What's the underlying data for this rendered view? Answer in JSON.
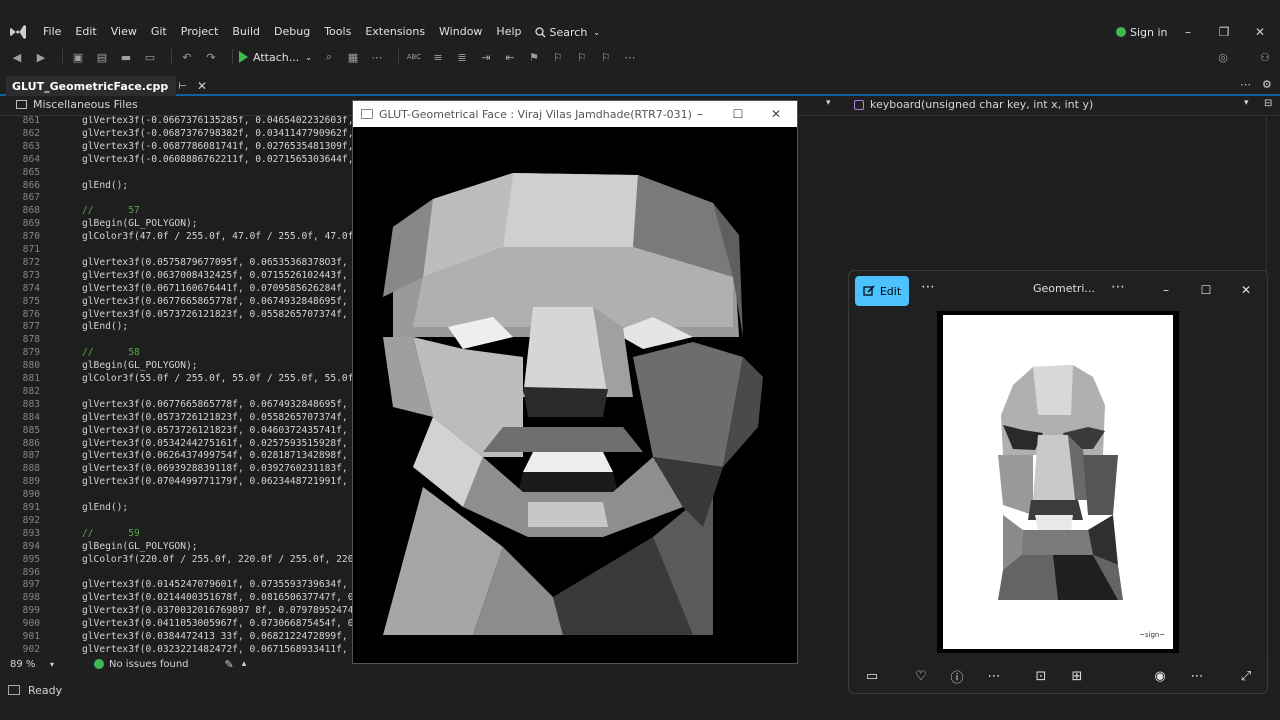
{
  "menubar": {
    "items": [
      "File",
      "Edit",
      "View",
      "Git",
      "Project",
      "Build",
      "Debug",
      "Tools",
      "Extensions",
      "Window",
      "Help"
    ],
    "search_label": "Search",
    "sign_in": "Sign in"
  },
  "toolbar": {
    "attach_label": "Attach..."
  },
  "tab": {
    "name": "GLUT_GeometricFace.cpp"
  },
  "navbar": {
    "scope": "Miscellaneous Files",
    "function": "keyboard(unsigned char key, int x, int y)"
  },
  "code_lines": [
    {
      "n": "861",
      "t": "glVertex3f(-0.0667376135285f, 0.0465402232603f, ",
      "c": false
    },
    {
      "n": "862",
      "t": "glVertex3f(-0.0687376798382f, 0.0341147790962f, ",
      "c": false
    },
    {
      "n": "863",
      "t": "glVertex3f(-0.0687786081741f, 0.0276535481309f, ",
      "c": false
    },
    {
      "n": "864",
      "t": "glVertex3f(-0.0608886762211f, 0.0271565303644f, 0",
      "c": false
    },
    {
      "n": "865",
      "t": "",
      "c": false
    },
    {
      "n": "866",
      "t": "glEnd();",
      "c": false
    },
    {
      "n": "867",
      "t": "",
      "c": false
    },
    {
      "n": "868",
      "t": "//      57",
      "c": true
    },
    {
      "n": "869",
      "t": "glBegin(GL_POLYGON);",
      "c": false
    },
    {
      "n": "870",
      "t": "glColor3f(47.0f / 255.0f, 47.0f / 255.0f, 47.0f",
      "c": false
    },
    {
      "n": "871",
      "t": "",
      "c": false
    },
    {
      "n": "872",
      "t": "glVertex3f(0.0575879677095f, 0.06535368378O3f, 0",
      "c": false
    },
    {
      "n": "873",
      "t": "glVertex3f(0.0637008432425f, 0.0715526102443f, 0",
      "c": false
    },
    {
      "n": "874",
      "t": "glVertex3f(0.0671160676441f, 0.0709585626284f, 0",
      "c": false
    },
    {
      "n": "875",
      "t": "glVertex3f(0.0677665865778f, 0.0674932848695f, 0",
      "c": false
    },
    {
      "n": "876",
      "t": "glVertex3f(0.0573726121823f, 0.0558265707374f, 0",
      "c": false
    },
    {
      "n": "877",
      "t": "glEnd();",
      "c": false
    },
    {
      "n": "878",
      "t": "",
      "c": false
    },
    {
      "n": "879",
      "t": "//      58",
      "c": true
    },
    {
      "n": "880",
      "t": "glBegin(GL_POLYGON);",
      "c": false
    },
    {
      "n": "881",
      "t": "glColor3f(55.0f / 255.0f, 55.0f / 255.0f, 55.0f",
      "c": false
    },
    {
      "n": "882",
      "t": "",
      "c": false
    },
    {
      "n": "883",
      "t": "glVertex3f(0.0677665865778f, 0.0674932848695f, 0",
      "c": false
    },
    {
      "n": "884",
      "t": "glVertex3f(0.0573726121823f, 0.0558265707374f, 0",
      "c": false
    },
    {
      "n": "885",
      "t": "glVertex3f(0.0573726121823f, 0.0460372435741f, 0",
      "c": false
    },
    {
      "n": "886",
      "t": "glVertex3f(0.0534244275161f, 0.0257593515928f, 0",
      "c": false
    },
    {
      "n": "887",
      "t": "glVertex3f(0.0626437499754f, 0.0281871342898f, 0",
      "c": false
    },
    {
      "n": "888",
      "t": "glVertex3f(0.0693928839118f, 0.0392760231183f, 0",
      "c": false
    },
    {
      "n": "889",
      "t": "glVertex3f(0.0704499771179f, 0.0623448721991f, 0.",
      "c": false
    },
    {
      "n": "890",
      "t": "",
      "c": false
    },
    {
      "n": "891",
      "t": "glEnd();",
      "c": false
    },
    {
      "n": "892",
      "t": "",
      "c": false
    },
    {
      "n": "893",
      "t": "//      59",
      "c": true
    },
    {
      "n": "894",
      "t": "glBegin(GL_POLYGON);",
      "c": false
    },
    {
      "n": "895",
      "t": "glColor3f(220.0f / 255.0f, 220.0f / 255.0f, 220.",
      "c": false
    },
    {
      "n": "896",
      "t": "",
      "c": false
    },
    {
      "n": "897",
      "t": "glVertex3f(0.0145247079601f, 0.0735593739634f, 0",
      "c": false
    },
    {
      "n": "898",
      "t": "glVertex3f(0.0214400351678f, 0.081650637747f, 0.0",
      "c": false
    },
    {
      "n": "899",
      "t": "glVertex3f(0.0370032016769897 8f, 0.0797895247436",
      "c": false
    },
    {
      "n": "900",
      "t": "glVertex3f(0.0411053005967f, 0.073066875454f, 0.",
      "c": false
    },
    {
      "n": "901",
      "t": "glVertex3f(0.0384472413 33f, 0.0682122472899f, 0.",
      "c": false
    },
    {
      "n": "902",
      "t": "glVertex3f(0.0323221482472f, 0.0671568933411f, 0",
      "c": false
    },
    {
      "n": "903",
      "t": "glVertex3f(0.0192052036 2f, 0.0694083150984f, 0.0",
      "c": false
    }
  ],
  "infobar": {
    "zoom": "89 %",
    "issues": "No issues found"
  },
  "statusbar": {
    "text": "Ready"
  },
  "glut_window": {
    "title": "GLUT-Geometrical Face : Viraj Vilas Jamdhade(RTR7-031)"
  },
  "photos_app": {
    "edit_label": "Edit",
    "title": "Geometri..."
  },
  "colors": {
    "accent": "#0e639c",
    "photos_accent": "#4cc2ff",
    "ok_green": "#3fb950",
    "comment": "#57a64a"
  }
}
